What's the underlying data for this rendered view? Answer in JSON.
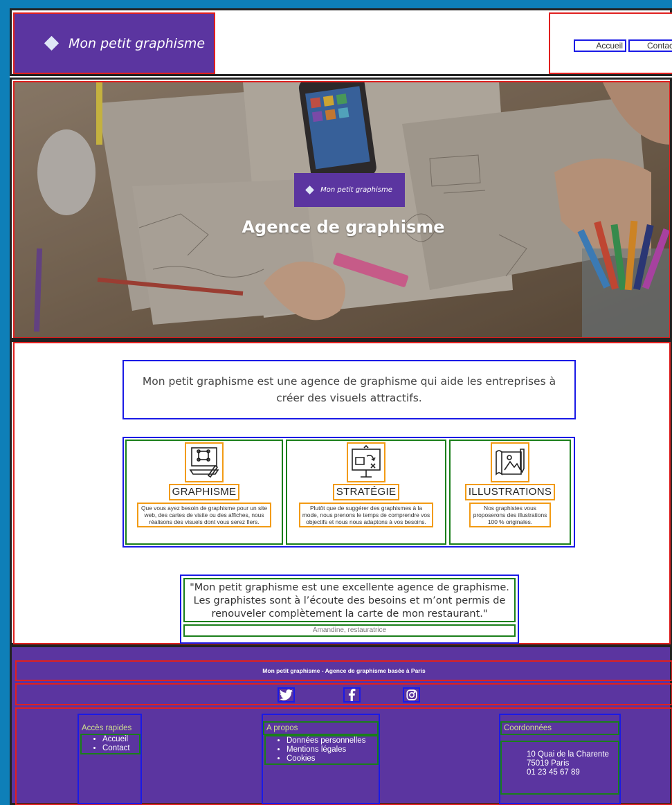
{
  "header": {
    "brand": "Mon petit graphisme",
    "nav": [
      {
        "label": "Accueil"
      },
      {
        "label": "Contact"
      }
    ]
  },
  "hero": {
    "brand": "Mon petit graphisme",
    "title": "Agence de graphisme"
  },
  "main": {
    "intro": "Mon petit graphisme est une agence de graphisme qui aide les entreprises à créer des visuels attractifs.",
    "services": [
      {
        "icon": "computer-design-icon",
        "title": "GRAPHISME",
        "description": "Que vous ayez besoin de graphisme pour un site web, des cartes de visite ou des affiches, nous réalisons des visuels dont vous serez fiers."
      },
      {
        "icon": "strategy-board-icon",
        "title": "STRATÉGIE",
        "description": "Plutôt que de suggérer des graphismes à la mode, nous prenons le temps de comprendre vos objectifs et nous nous adaptons à vos besoins."
      },
      {
        "icon": "illustration-map-icon",
        "title": "ILLUSTRATIONS",
        "description": "Nos graphistes vous proposerons des illustrations 100 % originales."
      }
    ],
    "testimonial": {
      "quote": "\"Mon petit graphisme est une excellente agence de graphisme. Les graphistes sont à l’écoute des besoins et m’ont permis de renouveler complètement la carte de mon restaurant.\"",
      "author": "Amandine, restauratrice"
    }
  },
  "footer": {
    "tagline": "Mon petit graphisme - Agence de graphisme basée à Paris",
    "social": [
      "twitter-icon",
      "facebook-icon",
      "instagram-icon"
    ],
    "columns": {
      "quick": {
        "title": "Accès rapides",
        "links": [
          "Accueil",
          "Contact"
        ]
      },
      "about": {
        "title": "A propos",
        "links": [
          "Données personnelles",
          "Mentions légales",
          "Cookies"
        ]
      },
      "contact": {
        "title": "Coordonnées",
        "address_line1": "10 Quai de la Charente",
        "address_line2": "75019 Paris",
        "phone": "01 23 45 67 89"
      }
    }
  },
  "colors": {
    "brand_purple": "#5b35a0",
    "page_border": "#0e7fb8"
  }
}
